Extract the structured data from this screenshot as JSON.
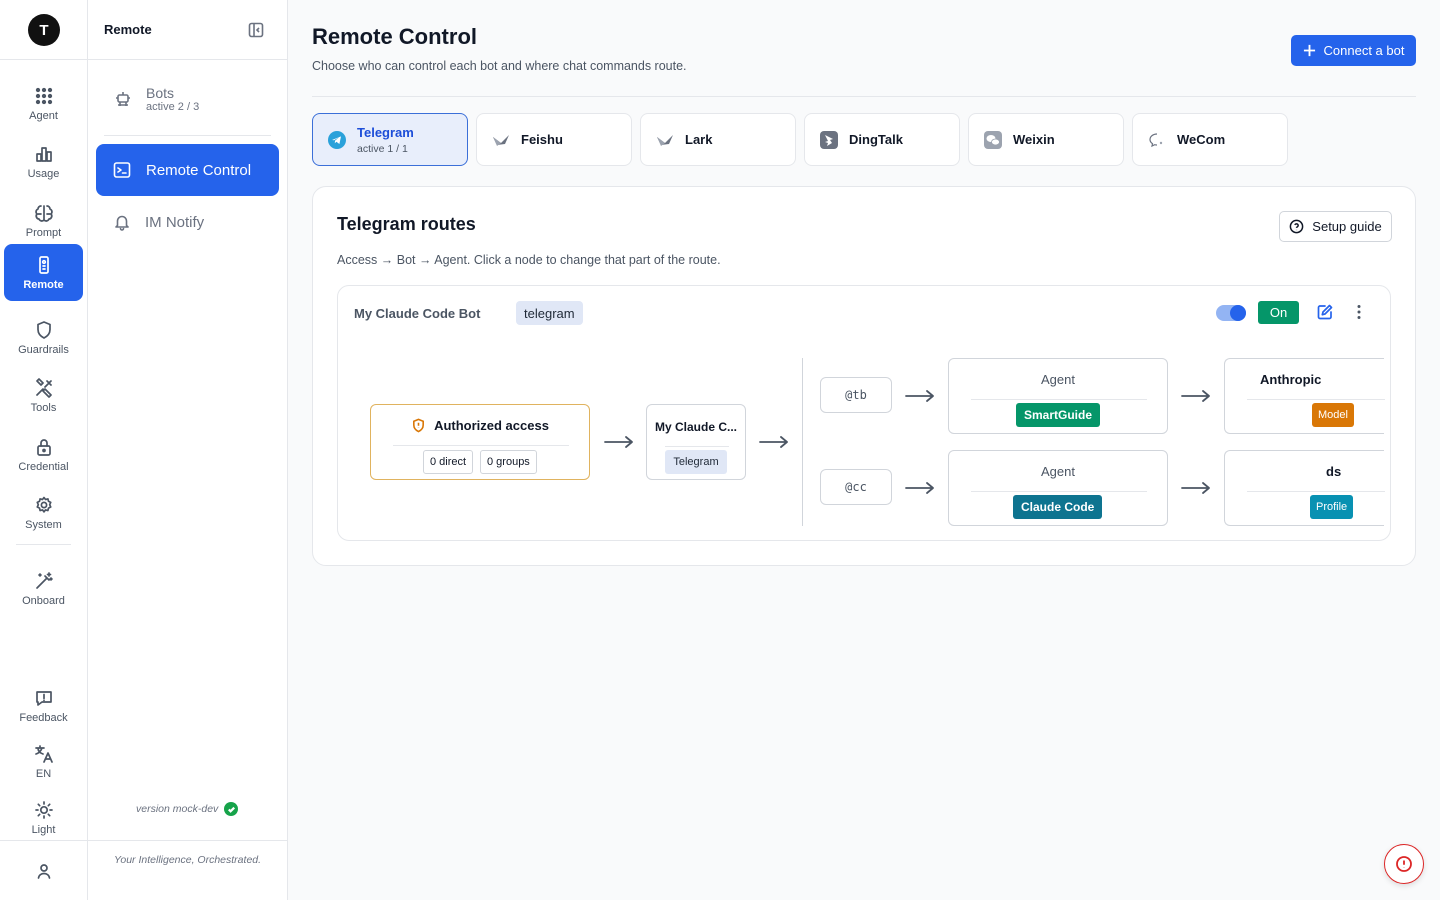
{
  "rail": {
    "logo": "T",
    "items": [
      {
        "label": "Agent",
        "icon": "grid-dots-icon"
      },
      {
        "label": "Usage",
        "icon": "bar-chart-icon"
      },
      {
        "label": "Prompt",
        "icon": "brain-icon"
      },
      {
        "label": "Remote",
        "icon": "remote-icon"
      },
      {
        "label": "Guardrails",
        "icon": "shield-icon"
      },
      {
        "label": "Tools",
        "icon": "tools-icon"
      },
      {
        "label": "Credential",
        "icon": "lock-icon"
      },
      {
        "label": "System",
        "icon": "gear-icon"
      },
      {
        "label": "Onboard",
        "icon": "magic-wand-icon"
      },
      {
        "label": "Feedback",
        "icon": "message-alert-icon"
      },
      {
        "label": "EN",
        "icon": "translate-icon"
      },
      {
        "label": "Light",
        "icon": "sun-icon"
      }
    ],
    "active": "Remote"
  },
  "subnav": {
    "title": "Remote",
    "bots": {
      "label": "Bots",
      "sub": "active 2 / 3"
    },
    "remote_control": "Remote Control",
    "im_notify": "IM Notify",
    "version": "version mock-dev",
    "tagline": "Your Intelligence, Orchestrated."
  },
  "header": {
    "title": "Remote Control",
    "subtitle": "Choose who can control each bot and where chat commands route.",
    "connect_button": "Connect a bot"
  },
  "platforms": [
    {
      "name": "Telegram",
      "sub": "active 1 / 1",
      "active": true,
      "icon": "telegram-icon"
    },
    {
      "name": "Feishu",
      "sub": "",
      "active": false,
      "icon": "feishu-icon"
    },
    {
      "name": "Lark",
      "sub": "",
      "active": false,
      "icon": "lark-icon"
    },
    {
      "name": "DingTalk",
      "sub": "",
      "active": false,
      "icon": "dingtalk-icon"
    },
    {
      "name": "Weixin",
      "sub": "",
      "active": false,
      "icon": "weixin-icon"
    },
    {
      "name": "WeCom",
      "sub": "",
      "active": false,
      "icon": "wecom-icon"
    }
  ],
  "routes": {
    "title": "Telegram routes",
    "setup_guide": "Setup guide",
    "description": "Access → Bot → Agent. Click a node to change that part of the route.",
    "bot": {
      "name": "My Claude Code Bot",
      "platform_chip": "telegram",
      "status": "On",
      "enabled": true
    },
    "access": {
      "title": "Authorized access",
      "direct": "0 direct",
      "groups": "0 groups"
    },
    "bot_node": {
      "title": "My Claude C...",
      "chip": "Telegram"
    },
    "commands": [
      {
        "command": "@tb",
        "agent_label": "Agent",
        "agent": "SmartGuide",
        "agent_color": "#059669",
        "model_label": "Anthropic",
        "model_chip": "Model",
        "model_color": "#d97706"
      },
      {
        "command": "@cc",
        "agent_label": "Agent",
        "agent": "Claude Code",
        "agent_color": "#0e7490",
        "model_label": "ds",
        "model_chip": "Profile",
        "model_color": "#0891b2"
      }
    ]
  },
  "colors": {
    "accent": "#2563eb",
    "on": "#059669",
    "danger": "#dc2626"
  }
}
